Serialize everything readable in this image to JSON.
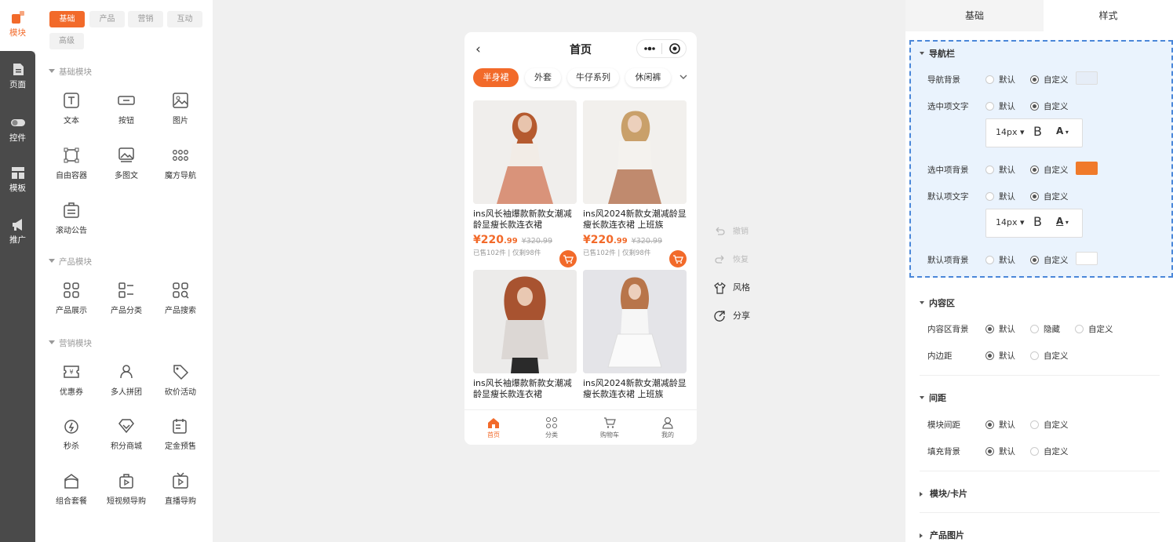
{
  "rail": {
    "items": [
      {
        "label": "模块",
        "icon": "module-icon"
      },
      {
        "label": "页面",
        "icon": "page-icon"
      },
      {
        "label": "控件",
        "icon": "toggle-icon"
      },
      {
        "label": "模板",
        "icon": "template-icon"
      },
      {
        "label": "推广",
        "icon": "megaphone-icon"
      }
    ]
  },
  "palette": {
    "tabs": [
      "基础",
      "产品",
      "营销",
      "互动",
      "高级"
    ],
    "sections": [
      "基础模块",
      "产品模块",
      "营销模块"
    ],
    "basic": [
      "文本",
      "按钮",
      "图片",
      "自由容器",
      "多图文",
      "魔方导航",
      "滚动公告"
    ],
    "product": [
      "产品展示",
      "产品分类",
      "产品搜索"
    ],
    "marketing": [
      "优惠券",
      "多人拼团",
      "砍价活动",
      "秒杀",
      "积分商城",
      "定金预售",
      "组合套餐",
      "短视频导购",
      "直播导购"
    ]
  },
  "phone": {
    "title": "首页",
    "chips": [
      "半身裙",
      "外套",
      "牛仔系列",
      "休闲裤"
    ],
    "products": [
      {
        "title": "ins风长袖爆款新款女潮减龄显瘦长款连衣裙",
        "price_int": "220",
        "price_dec": ".99",
        "orig": "¥320.99",
        "sold": "已售102件",
        "stock": "仅剩98件"
      },
      {
        "title": "ins风2024新款女潮减龄显瘦长款连衣裙 上班族",
        "price_int": "220",
        "price_dec": ".99",
        "orig": "¥320.99",
        "sold": "已售102件",
        "stock": "仅剩98件"
      },
      {
        "title": "ins风长袖爆款新款女潮减龄显瘦长款连衣裙"
      },
      {
        "title": "ins风2024新款女潮减龄显瘦长款连衣裙 上班族"
      }
    ],
    "tabbar": [
      "首页",
      "分类",
      "购物车",
      "我的"
    ]
  },
  "actions": {
    "undo": "撤销",
    "redo": "恢复",
    "style": "风格",
    "share": "分享"
  },
  "props": {
    "tabs": [
      "基础",
      "样式"
    ],
    "nav_section": "导航栏",
    "rows": {
      "nav_bg": "导航背景",
      "sel_text": "选中项文字",
      "sel_bg": "选中项背景",
      "def_text": "默认项文字",
      "def_bg": "默认项背景"
    },
    "opt_default": "默认",
    "opt_custom": "自定义",
    "opt_hide": "隐藏",
    "font_size": "14px",
    "content_section": "内容区",
    "content_bg": "内容区背景",
    "padding": "内边距",
    "spacing_section": "间距",
    "module_gap": "模块间距",
    "fill_bg": "填充背景",
    "card_section": "模块/卡片",
    "image_section": "产品图片",
    "colors": {
      "accent": "#f26a2a",
      "nav_swatch": "#e6edf7",
      "sel_swatch": "#f07a2a",
      "def_swatch": "#ffffff"
    }
  }
}
